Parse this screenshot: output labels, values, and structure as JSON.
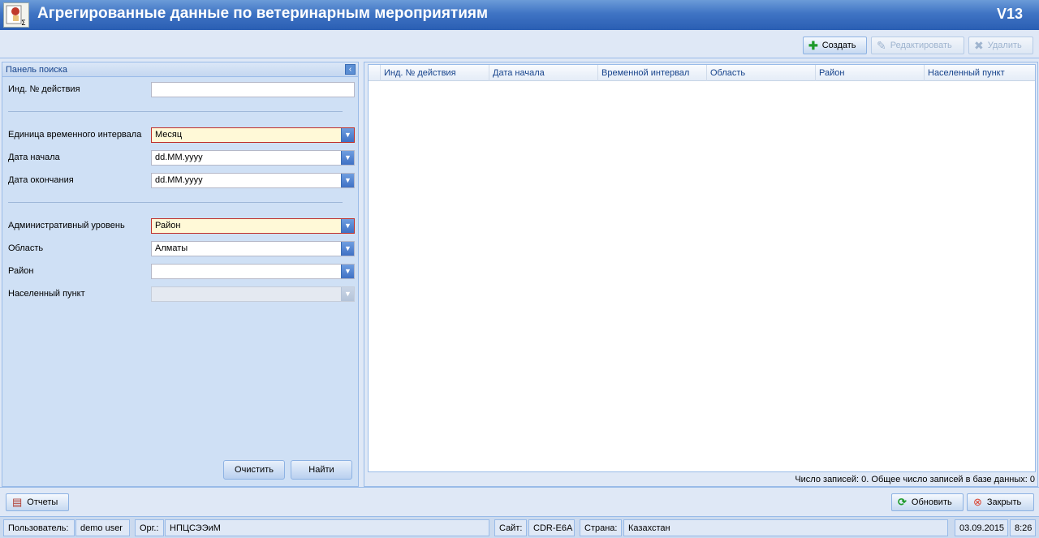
{
  "window": {
    "title": "Агрегированные данные по ветеринарным мероприятиям",
    "version": "V13"
  },
  "toolbar": {
    "create": "Создать",
    "edit": "Редактировать",
    "delete": "Удалить"
  },
  "search_panel": {
    "title": "Панель поиска",
    "fields": {
      "action_id": {
        "label": "Инд. № действия",
        "value": ""
      },
      "time_unit": {
        "label": "Единица временного интервала",
        "value": "Месяц"
      },
      "start_date": {
        "label": "Дата начала",
        "value": "dd.MM.yyyy"
      },
      "end_date": {
        "label": "Дата окончания",
        "value": "dd.MM.yyyy"
      },
      "admin_level": {
        "label": "Административный уровень",
        "value": "Район"
      },
      "region": {
        "label": "Область",
        "value": "Алматы"
      },
      "district": {
        "label": "Район",
        "value": ""
      },
      "settlement": {
        "label": "Населенный пункт",
        "value": ""
      }
    },
    "clear_button": "Очистить",
    "find_button": "Найти"
  },
  "grid": {
    "columns": [
      "Инд. № действия",
      "Дата начала",
      "Временной интервал",
      "Область",
      "Район",
      "Населенный пункт"
    ],
    "status": "Число записей: 0. Общее число записей в базе данных: 0"
  },
  "bottom": {
    "reports": "Отчеты",
    "refresh": "Обновить",
    "close": "Закрыть"
  },
  "statusbar": {
    "user_label": "Пользователь:",
    "user": "demo user",
    "org_label": "Орг.:",
    "org": "НПЦСЭЭиМ",
    "site_label": "Сайт:",
    "site": "CDR-E6A",
    "country_label": "Страна:",
    "country": "Казахстан",
    "date": "03.09.2015",
    "time": "8:26"
  },
  "colors": {
    "title_bar": "#3f74c4",
    "panel_bg": "#cfe0f5",
    "required_bg": "#fff9d7",
    "required_border": "#c0302a"
  }
}
